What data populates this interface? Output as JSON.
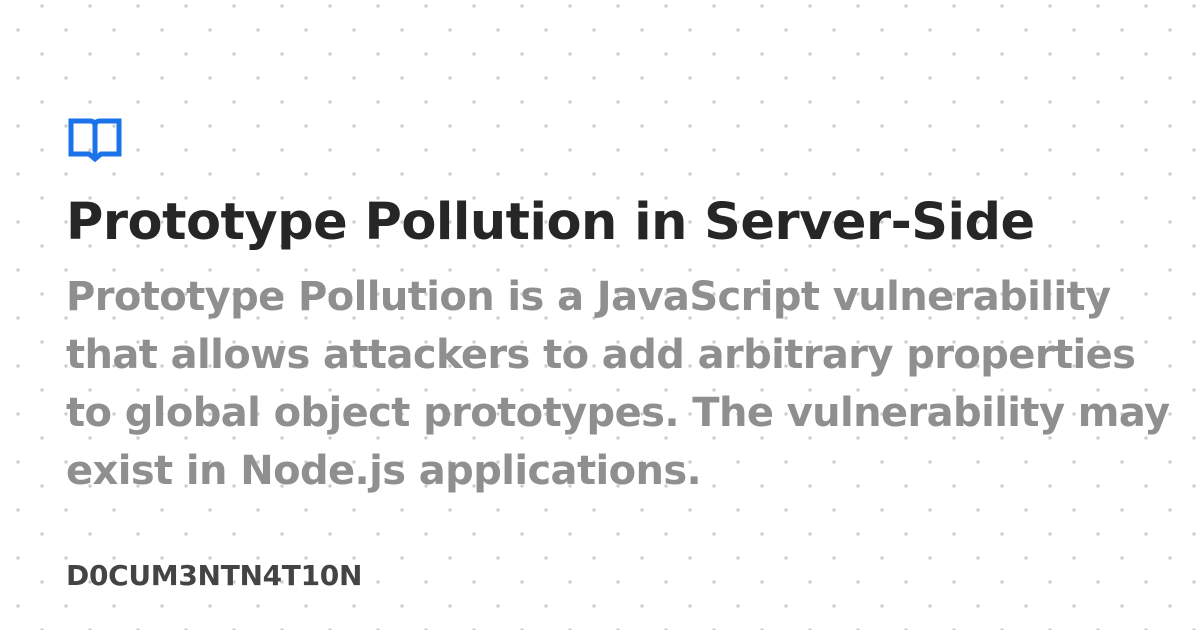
{
  "card": {
    "icon": "book-open-icon",
    "title": "Prototype Pollution in Server-Side",
    "description": "Prototype Pollution is a JavaScript vulnerability that allows attackers to add arbitrary properties to global object prototypes. The vulnerability may exist in Node.js applications.",
    "site_name": "D0CUM3NTN4T10N"
  },
  "colors": {
    "background": "#ffffff",
    "dot": "#cfcfcf",
    "accent": "#1a73e8",
    "title": "#262626",
    "description": "#8f8f8f",
    "site_name": "#444444"
  }
}
